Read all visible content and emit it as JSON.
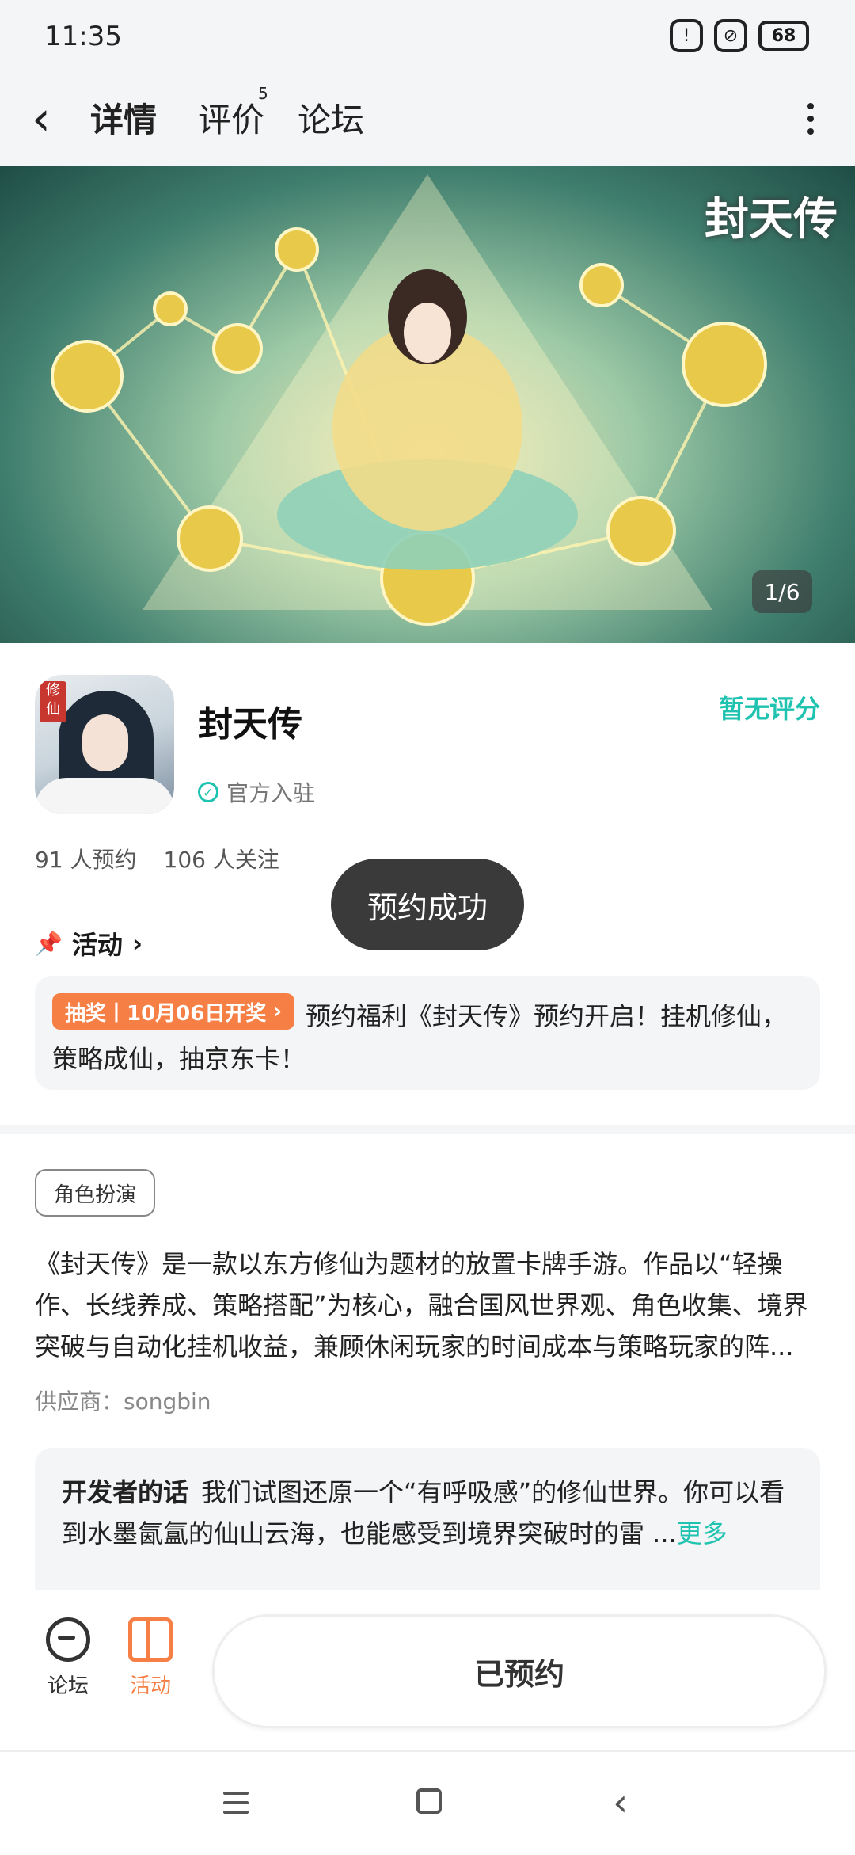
{
  "status_bar": {
    "time": "11:35",
    "battery": "68"
  },
  "nav": {
    "tabs": [
      {
        "label": "详情",
        "active": true
      },
      {
        "label": "评价",
        "badge": "5"
      },
      {
        "label": "论坛"
      }
    ]
  },
  "banner": {
    "logo": "封天传",
    "page_indicator": "1/6"
  },
  "app": {
    "name": "封天传",
    "icon_seal": "修仙",
    "official": "官方入驻",
    "rating": "暂无评分",
    "reservations": "91 人预约",
    "followers": "106 人关注"
  },
  "toast": "预约成功",
  "activity": {
    "heading": "活动",
    "tag": "抽奖丨10月06日开奖",
    "text_line1": "预约福利《封天传》预约开启！挂机修仙，",
    "text_line2": "策略成仙，抽京东卡！"
  },
  "details": {
    "genre": "角色扮演",
    "description": "《封天传》是一款以东方修仙为题材的放置卡牌手游。作品以“轻操作、长线养成、策略搭配”为核心，融合国风世界观、角色收集、境界突破与自动化挂机收益，兼顾休闲玩家的时间成本与策略玩家的阵...",
    "supplier": "供应商：songbin"
  },
  "developer_note": {
    "label": "开发者的话",
    "text": "我们试图还原一个“有呼吸感”的修仙世界。你可以看到水墨氤氲的仙山云海，也能感受到境界突破时的雷 ...",
    "more": "更多"
  },
  "bottom_bar": {
    "forum": "论坛",
    "activity": "活动",
    "reserved_button": "已预约"
  },
  "colors": {
    "accent": "#1fc3b0",
    "orange": "#f57f45",
    "toast": "#3a3a3a"
  }
}
